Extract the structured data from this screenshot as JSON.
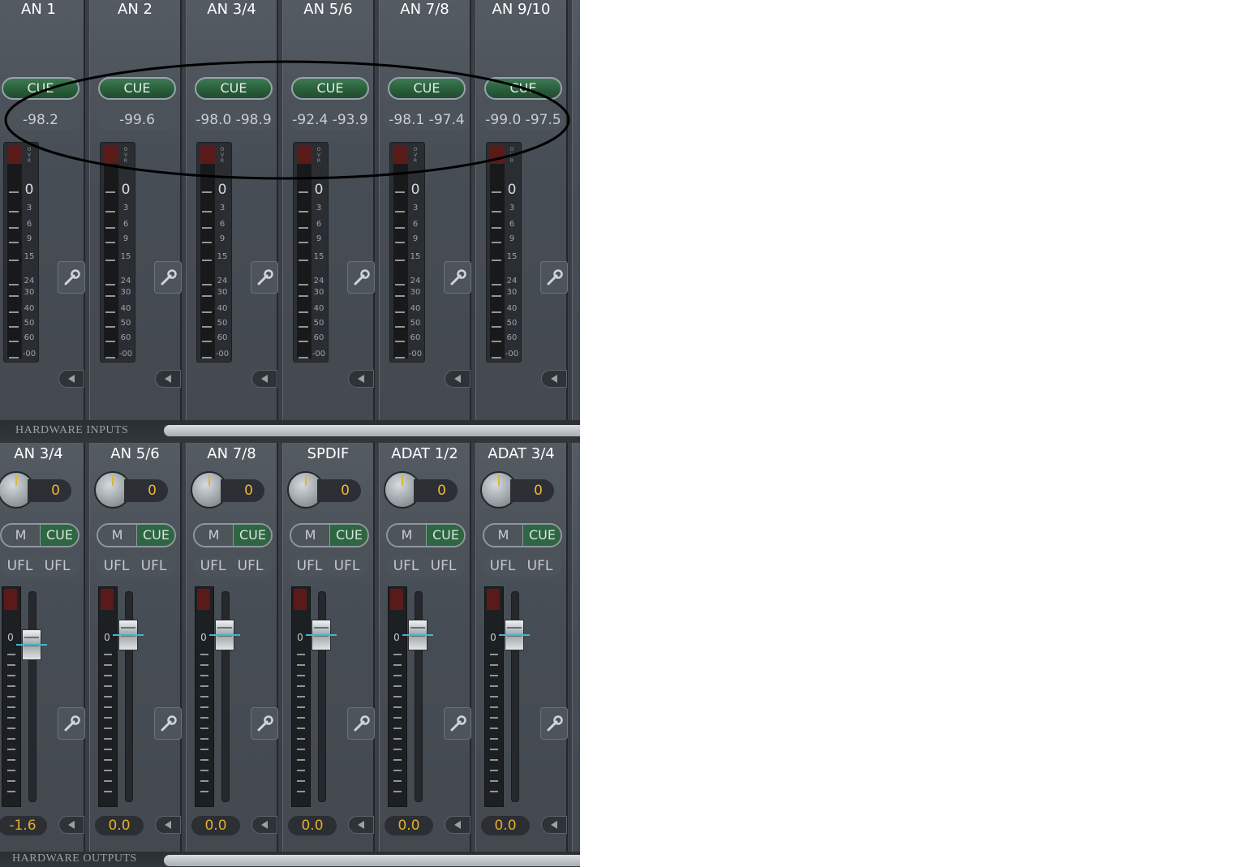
{
  "sections": {
    "inputs_label": "HARDWARE INPUTS",
    "outputs_label": "HARDWARE OUTPUTS"
  },
  "input_strips": [
    {
      "name": "AN 1",
      "cue": "CUE",
      "level": "-98.2"
    },
    {
      "name": "AN 2",
      "cue": "CUE",
      "level": "-99.6"
    },
    {
      "name": "AN 3/4",
      "cue": "CUE",
      "level": "-98.0 -98.9"
    },
    {
      "name": "AN 5/6",
      "cue": "CUE",
      "level": "-92.4 -93.9"
    },
    {
      "name": "AN 7/8",
      "cue": "CUE",
      "level": "-98.1 -97.4"
    },
    {
      "name": "AN 9/10",
      "cue": "CUE",
      "level": "-99.0 -97.5"
    }
  ],
  "meter_scale": {
    "ovr": "OVR",
    "labels": [
      "0",
      "3",
      "6",
      "9",
      "15",
      "24",
      "30",
      "40",
      "50",
      "60",
      "-00"
    ]
  },
  "output_strips": [
    {
      "name": "AN 3/4",
      "gain": "0",
      "mute": "M",
      "cue": "CUE",
      "ufl_left": "UFL",
      "ufl_right": "UFL",
      "meter_zero": "0",
      "volume": "-1.6"
    },
    {
      "name": "AN 5/6",
      "gain": "0",
      "mute": "M",
      "cue": "CUE",
      "ufl_left": "UFL",
      "ufl_right": "UFL",
      "meter_zero": "0",
      "volume": "0.0"
    },
    {
      "name": "AN 7/8",
      "gain": "0",
      "mute": "M",
      "cue": "CUE",
      "ufl_left": "UFL",
      "ufl_right": "UFL",
      "meter_zero": "0",
      "volume": "0.0"
    },
    {
      "name": "SPDIF",
      "gain": "0",
      "mute": "M",
      "cue": "CUE",
      "ufl_left": "UFL",
      "ufl_right": "UFL",
      "meter_zero": "0",
      "volume": "0.0"
    },
    {
      "name": "ADAT 1/2",
      "gain": "0",
      "mute": "M",
      "cue": "CUE",
      "ufl_left": "UFL",
      "ufl_right": "UFL",
      "meter_zero": "0",
      "volume": "0.0"
    },
    {
      "name": "ADAT 3/4",
      "gain": "0",
      "mute": "M",
      "cue": "CUE",
      "ufl_left": "UFL",
      "ufl_right": "UFL",
      "meter_zero": "0",
      "volume": "0.0"
    }
  ],
  "icons": {
    "settings": "wrench-icon",
    "collapse": "triangle-left-icon"
  },
  "colors": {
    "panel": "#3a3f45",
    "cue_green": "#2d6640",
    "display_amber": "#f0b732",
    "fader_marker": "#46b4c8",
    "annotation": "#000000"
  }
}
